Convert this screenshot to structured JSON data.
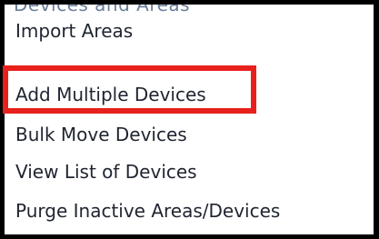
{
  "menu": {
    "top_partial": "Devices and Areas",
    "items": [
      {
        "label": "Import Areas"
      },
      {
        "label": "Add Multiple Devices"
      },
      {
        "label": "Bulk Move Devices"
      },
      {
        "label": "View List of Devices"
      },
      {
        "label": "Purge Inactive Areas/Devices"
      }
    ]
  },
  "colors": {
    "frame": "#000000",
    "menu_bg": "#ffffff",
    "text": "#1f2430",
    "highlight": "#e8201c"
  }
}
